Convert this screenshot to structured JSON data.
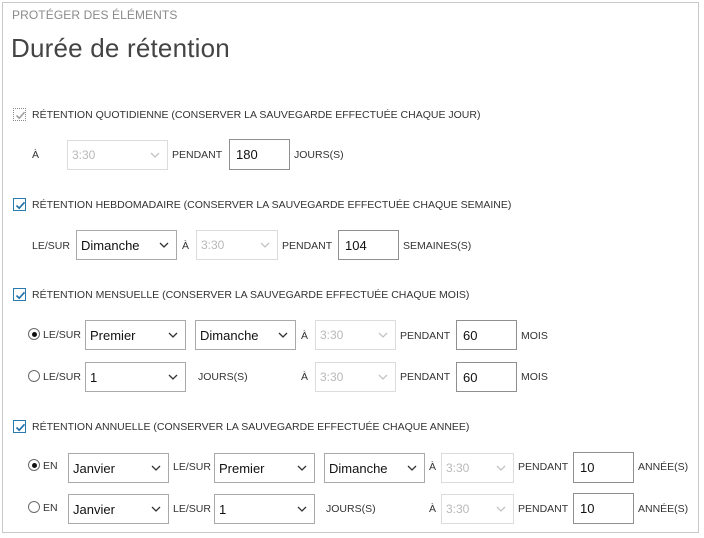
{
  "header": {
    "section": "PROTÉGER DES ÉLÉMENTS",
    "title": "Durée de rétention"
  },
  "daily": {
    "checked": true,
    "label": "RÉTENTION QUOTIDIENNE (CONSERVER LA SAUVEGARDE EFFECTUÉE CHAQUE JOUR)",
    "at_label": "À",
    "time": "3:30",
    "for_label": "PENDANT",
    "count": "180",
    "unit": "JOURS(S)"
  },
  "weekly": {
    "checked": true,
    "label": "RÉTENTION HEBDOMADAIRE (CONSERVER LA SAUVEGARDE EFFECTUÉE CHAQUE SEMAINE)",
    "on_label": "LE/SUR",
    "day": "Dimanche",
    "at_label": "À",
    "time": "3:30",
    "for_label": "PENDANT",
    "count": "104",
    "unit": "SEMAINES(S)"
  },
  "monthly": {
    "checked": true,
    "label": "RÉTENTION MENSUELLE (CONSERVER LA SAUVEGARDE EFFECTUÉE CHAQUE MOIS)",
    "opt1": {
      "selected": true,
      "on_label": "LE/SUR",
      "week": "Premier",
      "day": "Dimanche",
      "at_label": "À",
      "time": "3:30",
      "for_label": "PENDANT",
      "count": "60",
      "unit": "MOIS"
    },
    "opt2": {
      "selected": false,
      "on_label": "LE/SUR",
      "day_num": "1",
      "days_label": "JOURS(S)",
      "at_label": "À",
      "time": "3:30",
      "for_label": "PENDANT",
      "count": "60",
      "unit": "MOIS"
    }
  },
  "yearly": {
    "checked": true,
    "label": "RÉTENTION ANNUELLE (CONSERVER LA SAUVEGARDE EFFECTUÉE CHAQUE ANNEE)",
    "opt1": {
      "selected": true,
      "in_label": "EN",
      "month": "Janvier",
      "on_label": "LE/SUR",
      "week": "Premier",
      "day": "Dimanche",
      "at_label": "À",
      "time": "3:30",
      "for_label": "PENDANT",
      "count": "10",
      "unit": "ANNÉE(S)"
    },
    "opt2": {
      "selected": false,
      "in_label": "EN",
      "month": "Janvier",
      "on_label": "LE/SUR",
      "day_num": "1",
      "days_label": "JOURS(S)",
      "at_label": "À",
      "time": "3:30",
      "for_label": "PENDANT",
      "count": "10",
      "unit": "ANNÉE(S)"
    }
  }
}
